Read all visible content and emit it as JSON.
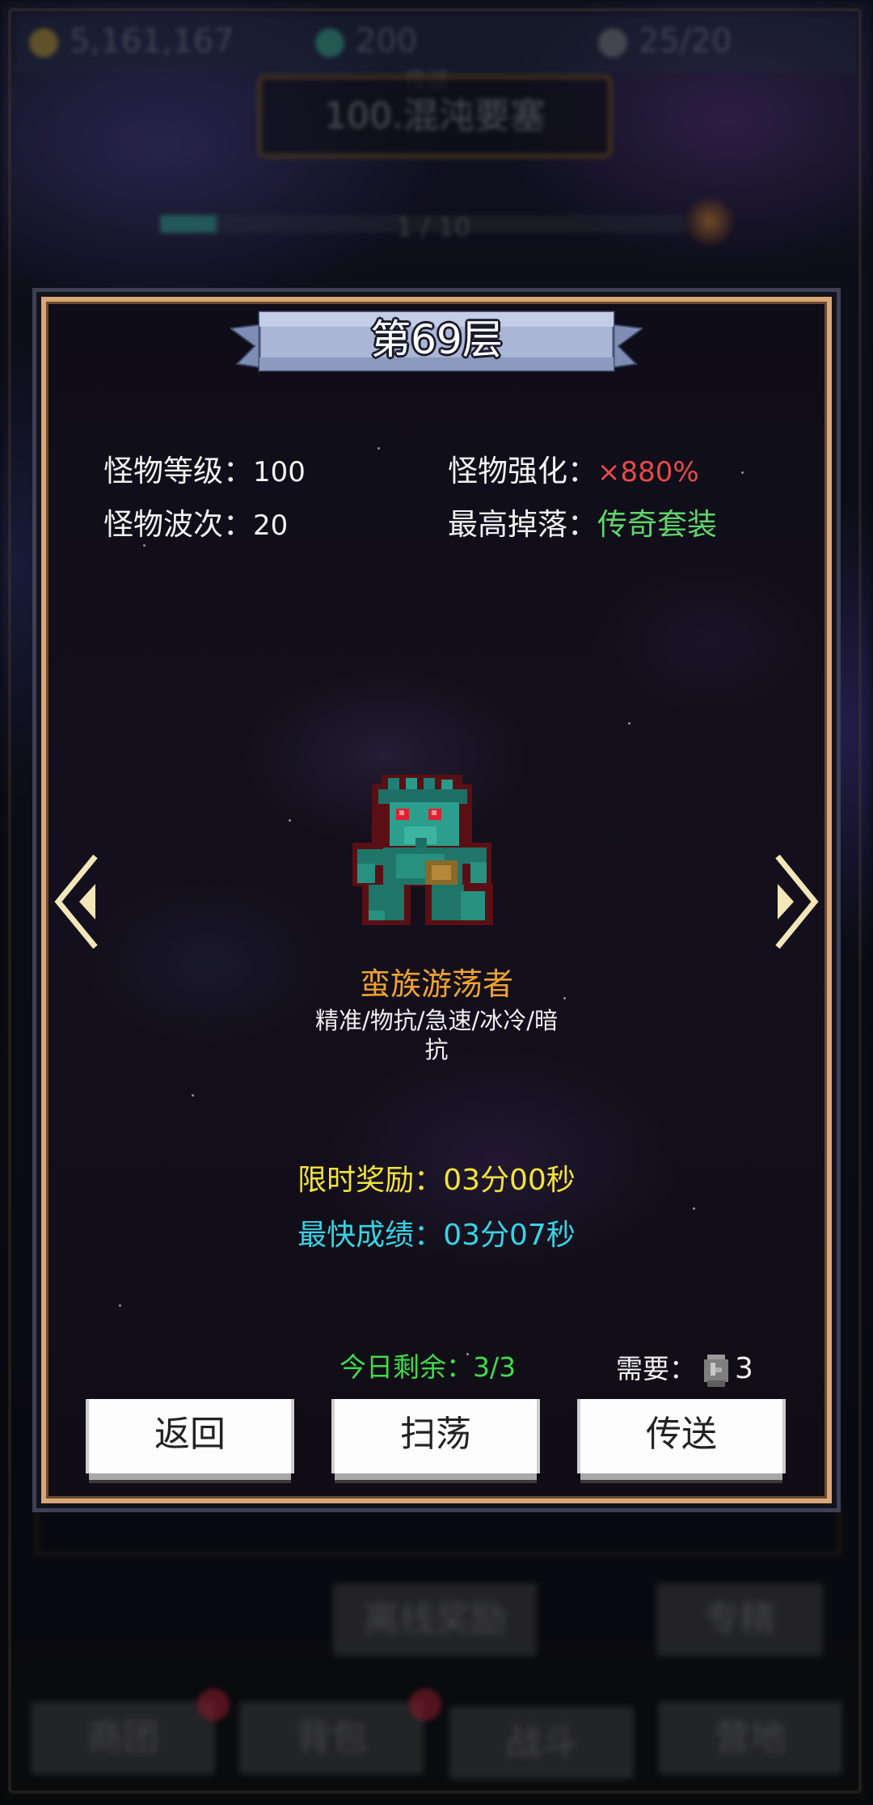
{
  "background": {
    "resources": [
      {
        "icon": "gold-coin-icon",
        "value": "5,161,167"
      },
      {
        "icon": "gem-icon",
        "value": "200"
      },
      {
        "icon": "stamina-icon",
        "value": "25/20"
      }
    ],
    "stage_label_small": "传送",
    "stage_title": "100.混沌要塞",
    "wave_progress": "1 / 10",
    "wave_progress_fraction": 0.1,
    "offline_reward_label": "离线奖励",
    "specialize_label": "专精",
    "nav": [
      {
        "label": "商团",
        "badge": "!"
      },
      {
        "label": "背包",
        "badge": "!"
      },
      {
        "label": "战斗",
        "badge": ""
      },
      {
        "label": "营地",
        "badge": ""
      }
    ]
  },
  "dialog": {
    "title": "第69层",
    "monster_level_label": "怪物等级：",
    "monster_level": "100",
    "monster_boost_label": "怪物强化：",
    "monster_boost": "×880%",
    "monster_waves_label": "怪物波次：",
    "monster_waves": "20",
    "max_drop_label": "最高掉落：",
    "max_drop": "传奇套装",
    "monster_name": "蛮族游荡者",
    "monster_traits_line1": "精准/物抗/急速/冰冷/暗",
    "monster_traits_line2": "抗",
    "time_reward_label": "限时奖励：",
    "time_reward": "03分00秒",
    "best_time_label": "最快成绩：",
    "best_time": "03分07秒",
    "remaining_label": "今日剩余：",
    "remaining": "3/3",
    "need_label": "需要：",
    "need_count": "3",
    "need_icon": "stone-icon",
    "buttons": {
      "back": "返回",
      "sweep": "扫荡",
      "teleport": "传送"
    }
  },
  "colors": {
    "frame_gold": "#d9a679",
    "boost_red": "#e84a4a",
    "drop_green": "#5fd56a",
    "name_orange": "#f0a230",
    "timer_yellow": "#f2e33a",
    "timer_cyan": "#36d4e6",
    "remaining_green": "#3fdc4a"
  }
}
